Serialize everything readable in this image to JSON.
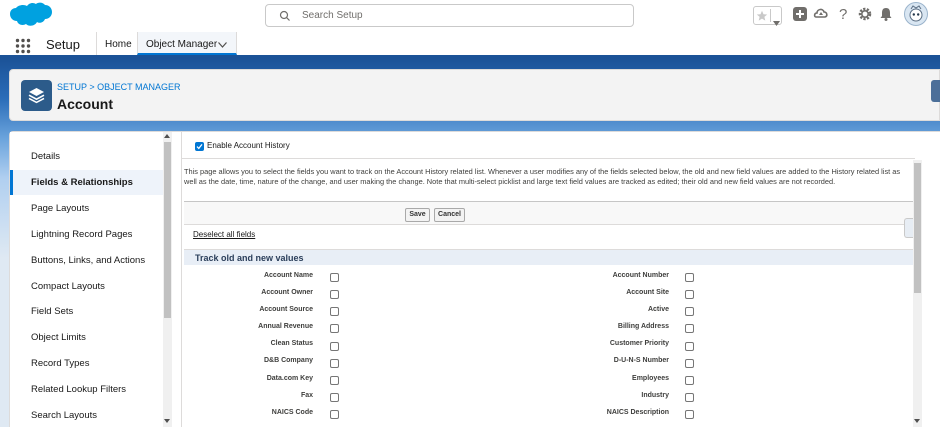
{
  "global_header": {
    "search_placeholder": "Search Setup"
  },
  "context_bar": {
    "app_name": "Setup",
    "tabs": [
      {
        "label": "Home"
      },
      {
        "label": "Object Manager"
      }
    ]
  },
  "page_header": {
    "breadcrumb": "SETUP > OBJECT MANAGER",
    "title": "Account"
  },
  "sidebar": {
    "items": [
      {
        "label": "Details"
      },
      {
        "label": "Fields & Relationships"
      },
      {
        "label": "Page Layouts"
      },
      {
        "label": "Lightning Record Pages"
      },
      {
        "label": "Buttons, Links, and Actions"
      },
      {
        "label": "Compact Layouts"
      },
      {
        "label": "Field Sets"
      },
      {
        "label": "Object Limits"
      },
      {
        "label": "Record Types"
      },
      {
        "label": "Related Lookup Filters"
      },
      {
        "label": "Search Layouts"
      }
    ]
  },
  "history": {
    "enable_label": "Enable Account History",
    "description": "This page allows you to select the fields you want to track on the Account History related list. Whenever a user modifies any of the fields selected below, the old and new field values are added to the History related list as well as the date, time, nature of the change, and user making the change. Note that multi-select picklist and large text field values are tracked as edited; their old and new field values are not recorded.",
    "save_label": "Save",
    "cancel_label": "Cancel",
    "deselect_label": "Deselect all fields",
    "section_title": "Track old and new values",
    "left_fields": [
      "Account Name",
      "Account Owner",
      "Account Source",
      "Annual Revenue",
      "Clean Status",
      "D&B Company",
      "Data.com Key",
      "Fax",
      "NAICS Code"
    ],
    "right_fields": [
      "Account Number",
      "Account Site",
      "Active",
      "Billing Address",
      "Customer Priority",
      "D-U-N-S Number",
      "Employees",
      "Industry",
      "NAICS Description"
    ]
  },
  "colors": {
    "brand": "#0176d3",
    "header_blue": "#1b5297"
  },
  "icons": [
    "salesforce-cloud-logo",
    "search-icon",
    "star-icon",
    "chevron-down-icon",
    "plus-icon",
    "trailhead-icon",
    "help-icon",
    "gear-icon",
    "bell-icon",
    "avatar",
    "app-launcher-icon",
    "layers-icon",
    "checkmark-icon"
  ]
}
